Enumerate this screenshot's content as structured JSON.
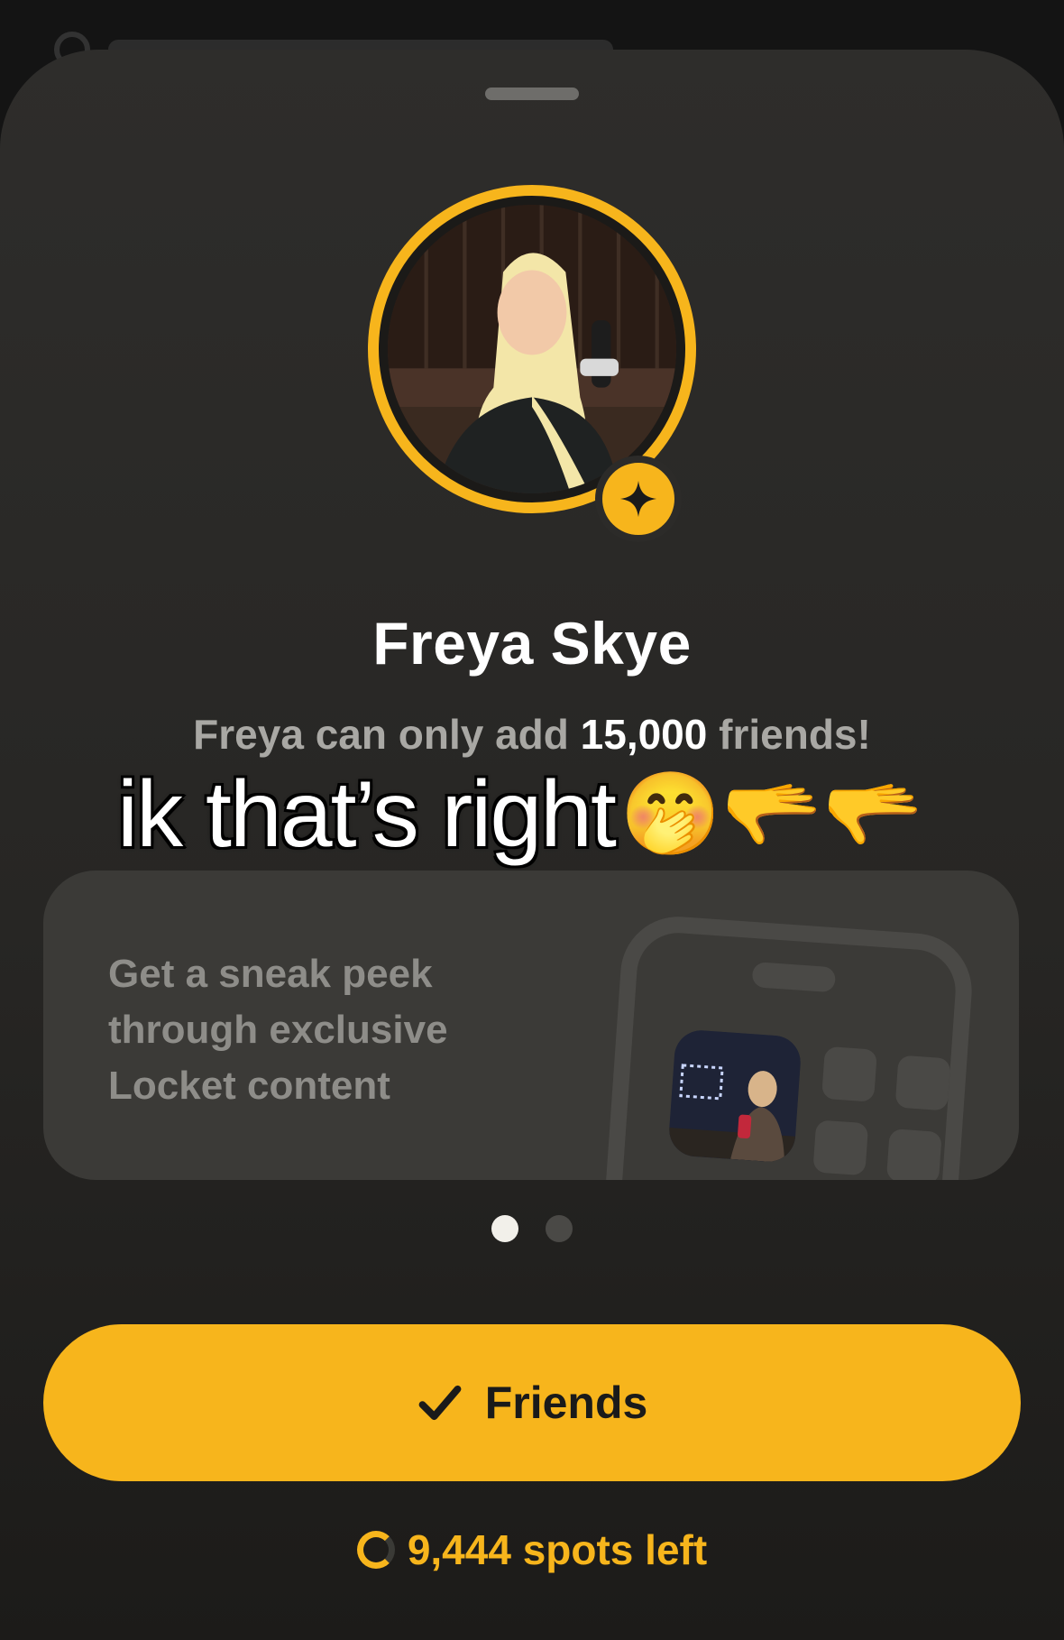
{
  "profile": {
    "name": "Freya Skye",
    "subtitle_pre": "Freya can only add ",
    "subtitle_count": "15,000",
    "subtitle_post": " friends!"
  },
  "caption": {
    "text": "ik that’s right",
    "emojis": "🤭🫳🫳"
  },
  "feature_card": {
    "text": "Get a sneak peek through exclusive Locket content"
  },
  "pagination": {
    "total": 2,
    "active_index": 0
  },
  "action": {
    "button_label": "Friends",
    "spots_left": "9,444 spots left"
  },
  "colors": {
    "accent": "#f7b51c",
    "sheet": "#2e2d2b"
  },
  "icons": {
    "badge": "sparkle-star-icon",
    "button": "checkmark-icon",
    "spots": "loading-ring-icon"
  }
}
